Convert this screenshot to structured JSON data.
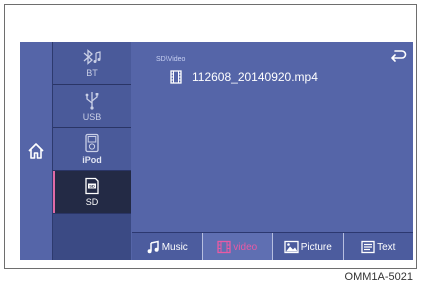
{
  "screen": {
    "path": "SD\\Video",
    "file": {
      "name": "112608_20140920.mp4"
    },
    "sources": [
      {
        "id": "bt",
        "label": "BT",
        "icon": "bluetooth-music-icon"
      },
      {
        "id": "usb",
        "label": "USB",
        "icon": "usb-icon"
      },
      {
        "id": "ipod",
        "label": "iPod",
        "icon": "ipod-icon"
      },
      {
        "id": "sd",
        "label": "SD",
        "icon": "sd-card-icon",
        "active": true
      }
    ],
    "tabs": [
      {
        "id": "music",
        "label": "Music",
        "icon": "music-note-icon"
      },
      {
        "id": "video",
        "label": "video",
        "icon": "film-strip-icon",
        "active": true
      },
      {
        "id": "picture",
        "label": "Picture",
        "icon": "picture-icon"
      },
      {
        "id": "text",
        "label": "Text",
        "icon": "text-doc-icon"
      }
    ]
  },
  "caption": "OMM1A-5021",
  "colors": {
    "background": "#5565a8",
    "source_column": "#3b4a84",
    "active_source": "#232a45",
    "active_tab_text": "#e85aa4"
  }
}
